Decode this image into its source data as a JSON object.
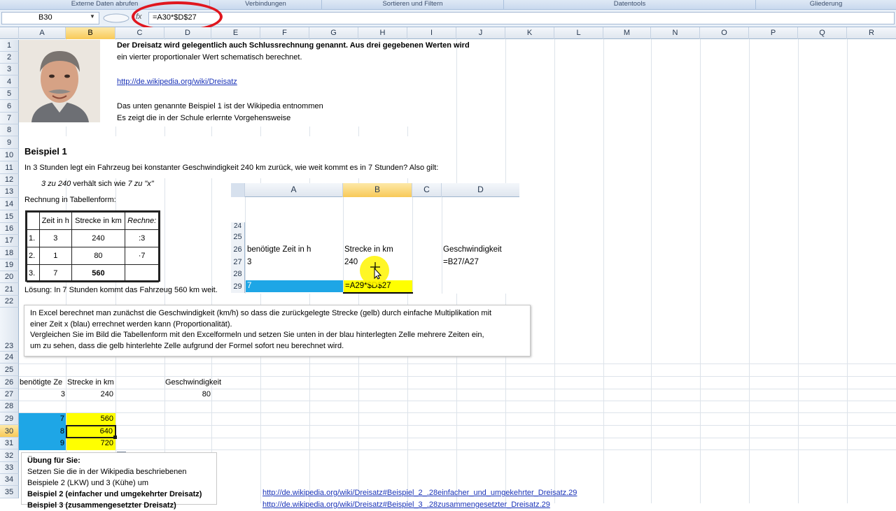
{
  "ribbon": {
    "groups": [
      "Externe Daten abrufen",
      "Verbindungen",
      "Sortieren und Filtern",
      "Datentools",
      "Gliederung"
    ]
  },
  "formula_bar": {
    "name_box": "B30",
    "fx_label": "fx",
    "formula": "=A30*$D$27"
  },
  "columns": [
    "A",
    "B",
    "C",
    "D",
    "E",
    "F",
    "G",
    "H",
    "I",
    "J",
    "K",
    "L",
    "M",
    "N",
    "O",
    "P",
    "Q",
    "R"
  ],
  "selected_column": "B",
  "rows": [
    "1",
    "2",
    "3",
    "4",
    "5",
    "6",
    "7",
    "8",
    "9",
    "10",
    "11",
    "12",
    "13",
    "14",
    "15",
    "16",
    "17",
    "18",
    "19",
    "20",
    "21",
    "22",
    "23",
    "24",
    "25",
    "26",
    "27",
    "28",
    "29",
    "30",
    "31",
    "32",
    "33",
    "34",
    "35"
  ],
  "selected_row": "30",
  "intro": {
    "line1": "Der Dreisatz wird gelegentlich auch Schlussrechnung genannt. Aus drei gegebenen Werten wird",
    "line2": "ein vierter proportionaler Wert schematisch berechnet.",
    "link": "http://de.wikipedia.org/wiki/Dreisatz",
    "line3": "Das unten genannte Beispiel 1 ist der Wikipedia entnommen",
    "line4": "Es zeigt die in der Schule erlernte Vorgehensweise"
  },
  "example": {
    "title": "Beispiel 1",
    "text": "In 3 Stunden legt ein Fahrzeug bei konstanter Geschwindigkeit 240 km zurück, wie weit kommt es in 7 Stunden? Also gilt:",
    "ratio_a": "3 zu 240",
    "ratio_mid": " verhält sich wie ",
    "ratio_b": "7 zu \"x\"",
    "table_title": "Rechnung in Tabellenform:",
    "table": {
      "headers": [
        "",
        "Zeit in h",
        "Strecke in km",
        "Rechne:"
      ],
      "rows": [
        [
          "1.",
          "3",
          "240",
          ":3"
        ],
        [
          "2.",
          "1",
          "80",
          "·7"
        ],
        [
          "3.",
          "7",
          "560",
          ""
        ]
      ]
    },
    "solution": "Lösung: In 7 Stunden kommt das Fahrzeug 560 km weit."
  },
  "zoom": {
    "columns": [
      "A",
      "B",
      "C",
      "D"
    ],
    "rows": [
      "24",
      "25",
      "26",
      "27",
      "28",
      "29"
    ],
    "cells": {
      "a26": "benötigte Zeit in h",
      "b26": "Strecke in km",
      "d26": "Geschwindigkeit",
      "a27": "3",
      "b27": "240",
      "d27": "=B27/A27",
      "a29": "7",
      "b29": "=A29*$D$27"
    }
  },
  "note": {
    "l1": "In Excel berechnet man zunächst die Geschwindigkeit (km/h) so dass die zurückgelegte Strecke (gelb)  durch einfache Multiplikation mit",
    "l2": "einer Zeit x (blau) errechnet werden kann (Proportionalität).",
    "l3": "Vergleichen Sie im Bild die Tabellenform mit den Excelformeln und  setzen Sie unten in der blau hinterlegten Zelle mehrere Zeiten ein,",
    "l4": "um zu sehen, dass die gelb hinterlehte Zelle aufgrund der Formel sofort neu berechnet wird."
  },
  "lower": {
    "a26": "benötigte Ze",
    "b26": "Strecke in km",
    "d26": "Geschwindigkeit",
    "a27": "3",
    "b27": "240",
    "d27": "80",
    "a29": "7",
    "b29": "560",
    "a30": "8",
    "b30": "640",
    "a31": "9",
    "b31": "720"
  },
  "uebung": {
    "title": "Übung für Sie:",
    "l1": "Setzen Sie die in der Wikipedia beschriebenen",
    "l2": "Beispiele 2  (LKW) und 3 (Kühe) um",
    "l3": "Beispiel 2 (einfacher und umgekehrter Dreisatz)",
    "l4": "Beispiel 3 (zusammengesetzter Dreisatz)"
  },
  "links": {
    "l1": "http://de.wikipedia.org/wiki/Dreisatz#Beispiel_2_.28einfacher_und_umgekehrter_Dreisatz.29",
    "l2": "http://de.wikipedia.org/wiki/Dreisatz#Beispiel_3_.28zusammengesetzter_Dreisatz.29"
  },
  "colors": {
    "blue_fill": "#1ea6e6",
    "yellow_fill": "#ffff00",
    "red_marker": "#e0161e",
    "link": "#1a33b8"
  }
}
